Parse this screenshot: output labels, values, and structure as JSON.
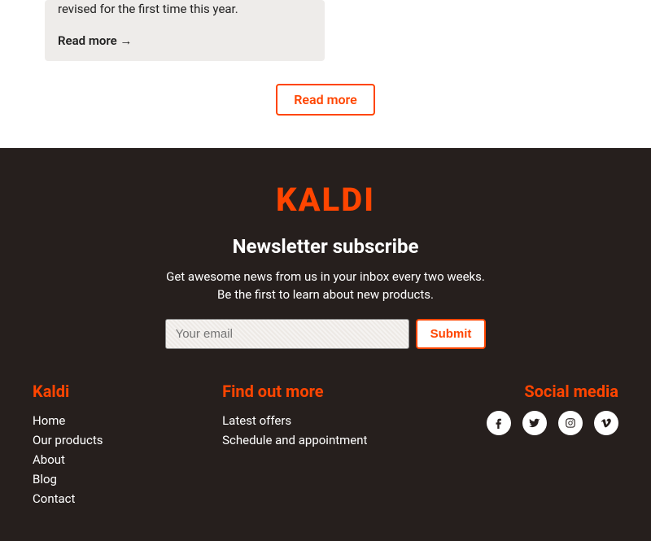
{
  "article": {
    "excerpt": "revised for the first time this year.",
    "read_more_link": "Read more →",
    "read_more_button": "Read more"
  },
  "footer": {
    "brand": "KALDI",
    "newsletter": {
      "title": "Newsletter subscribe",
      "description": "Get awesome news from us in your inbox every two weeks. Be the first to learn about new products.",
      "placeholder": "Your email",
      "submit": "Submit"
    },
    "cols": [
      {
        "title": "Kaldi",
        "items": [
          "Home",
          "Our products",
          "About",
          "Blog",
          "Contact"
        ]
      },
      {
        "title": "Find out more",
        "items": [
          "Latest offers",
          "Schedule and appointment"
        ]
      }
    ],
    "social": {
      "title": "Social media",
      "icons": [
        "facebook",
        "twitter",
        "instagram",
        "vimeo"
      ]
    }
  }
}
